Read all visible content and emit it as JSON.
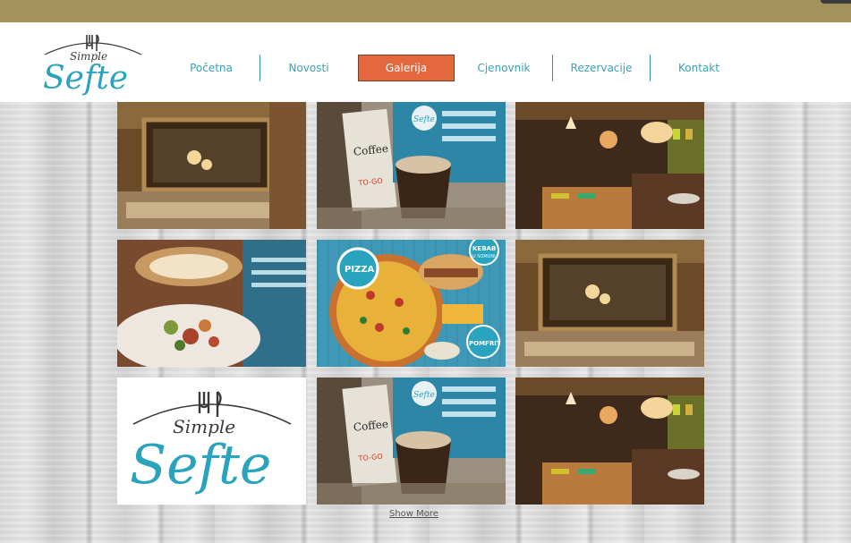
{
  "logo": {
    "line1": "Simple",
    "line2": "Sefte"
  },
  "nav": {
    "items": [
      {
        "label": "Početna"
      },
      {
        "label": "Novosti"
      },
      {
        "label": "Galerija"
      },
      {
        "label": "Cjenovnik"
      },
      {
        "label": "Rezervacije"
      },
      {
        "label": "Kontakt"
      }
    ],
    "active_index": 2
  },
  "gallery": {
    "tiles": [
      {
        "kind": "cafe-window"
      },
      {
        "kind": "coffee-menu",
        "text_coffee": "Coffee",
        "text_togo": "TO-GO",
        "text_sefte": "Sefte"
      },
      {
        "kind": "restaurant-interior"
      },
      {
        "kind": "salad-plate"
      },
      {
        "kind": "pizza-menu",
        "text_pizza": "PIZZA",
        "text_kebab": "KEBAB",
        "text_somun": "U SOMUNU",
        "text_pomfrit": "POMFRIT"
      },
      {
        "kind": "cafe-window"
      },
      {
        "kind": "logo-tile",
        "line1": "Simple",
        "line2": "Sefte"
      },
      {
        "kind": "coffee-menu",
        "text_coffee": "Coffee",
        "text_togo": "TO-GO",
        "text_sefte": "Sefte"
      },
      {
        "kind": "restaurant-interior"
      }
    ],
    "show_more_label": "Show More"
  },
  "colors": {
    "topbar": "#a3925c",
    "nav_text": "#3aa0b5",
    "nav_active_bg": "#e4683e",
    "logo_teal": "#2aa3bf"
  }
}
